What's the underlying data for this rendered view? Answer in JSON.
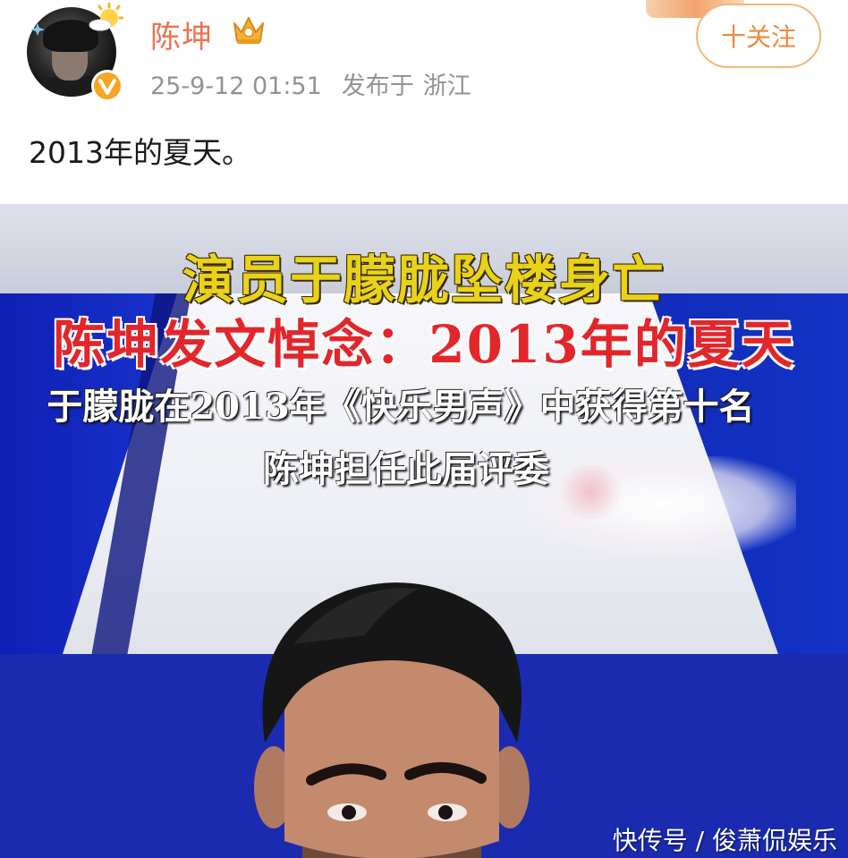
{
  "post": {
    "author": {
      "name": "陈坤",
      "avatar": "avatar",
      "badges": [
        "sun-icon",
        "sparkle-icon",
        "verified-icon",
        "crown-icon"
      ]
    },
    "timestamp": "25-9-12 01:51",
    "published_from": "发布于",
    "location": "浙江",
    "follow_label": "十关注",
    "text": "2013年的夏天。"
  },
  "video": {
    "captions": {
      "line1": "演员于朦胧坠楼身亡",
      "line2": "陈坤发文悼念：2013年的夏天",
      "line3": "于朦胧在2013年《快乐男声》中获得第十名",
      "line4": "陈坤担任此届评委"
    }
  },
  "watermark": "快传号 / 俊萧侃娱乐",
  "colors": {
    "username": "#eb7350",
    "follow_border": "#f0b87a",
    "follow_text": "#e98a3c",
    "caption_yellow": "#e8d21a",
    "caption_red": "#e3262b",
    "stage_blue": "#1630c9",
    "verified_badge": "#f5a623"
  }
}
